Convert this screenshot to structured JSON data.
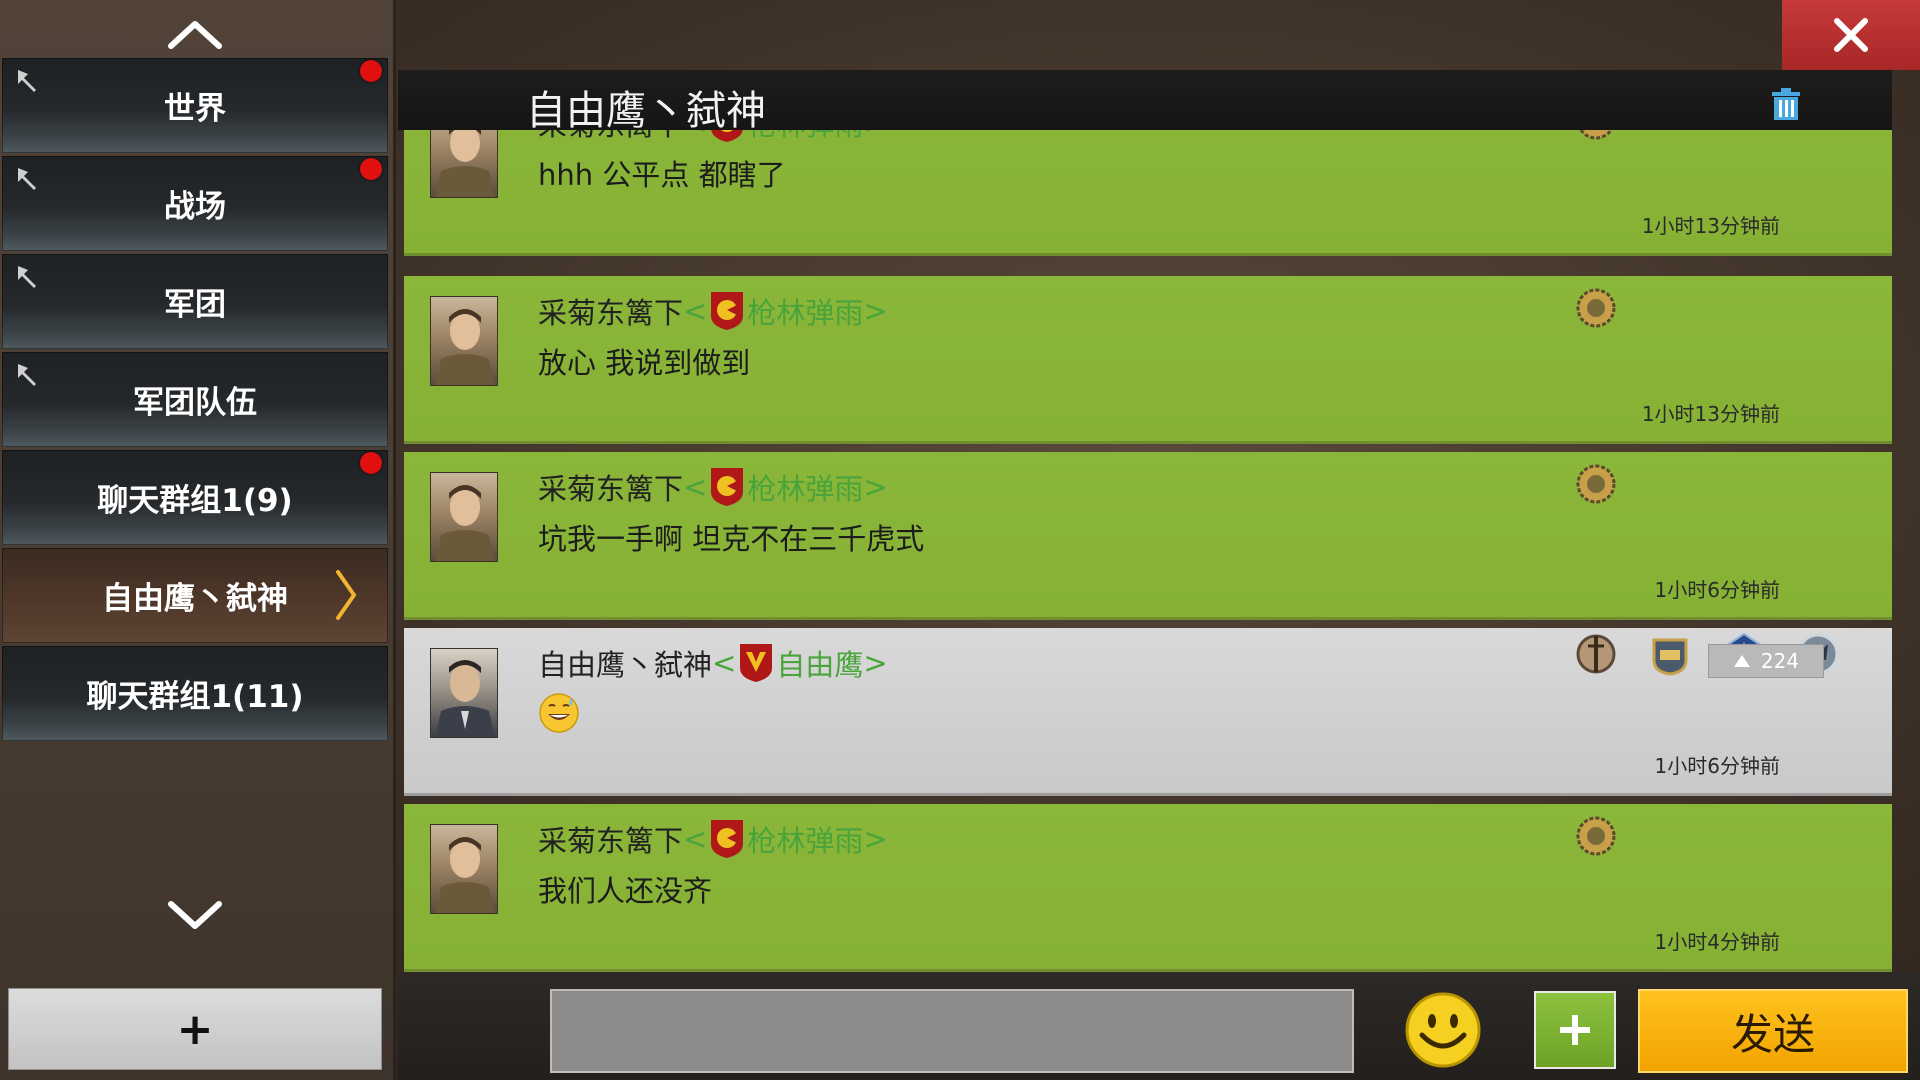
{
  "sidebar": {
    "items": [
      {
        "label": "世界",
        "pinned": true,
        "unread": true,
        "active": false
      },
      {
        "label": "战场",
        "pinned": true,
        "unread": true,
        "active": false
      },
      {
        "label": "军团",
        "pinned": true,
        "unread": false,
        "active": false
      },
      {
        "label": "军团队伍",
        "pinned": true,
        "unread": false,
        "active": false
      },
      {
        "label": "聊天群组1(9)",
        "pinned": false,
        "unread": true,
        "active": false
      },
      {
        "label": "自由鹰丶弑神",
        "pinned": false,
        "unread": false,
        "active": true
      },
      {
        "label": "聊天群组1(11)",
        "pinned": false,
        "unread": false,
        "active": false
      }
    ],
    "add_button_label": "+"
  },
  "header": {
    "title": "自由鹰丶弑神"
  },
  "messages": [
    {
      "sender": "采菊东篱下",
      "guild": "枪林弹雨",
      "text": "hhh 公平点 都瞎了",
      "time": "1小时13分钟前",
      "own": false
    },
    {
      "sender": "采菊东篱下",
      "guild": "枪林弹雨",
      "text": "放心 我说到做到",
      "time": "1小时13分钟前",
      "own": false
    },
    {
      "sender": "采菊东篱下",
      "guild": "枪林弹雨",
      "text": "坑我一手啊 坦克不在三千虎式",
      "time": "1小时6分钟前",
      "own": false
    },
    {
      "sender": "自由鹰丶弑神",
      "guild": "自由鹰",
      "text": "",
      "time": "1小时6分钟前",
      "own": true,
      "likes": "224"
    },
    {
      "sender": "采菊东篱下",
      "guild": "枪林弹雨",
      "text": "我们人还没齐",
      "time": "1小时4分钟前",
      "own": false
    }
  ],
  "bracket_open": "<",
  "bracket_close": ">",
  "input": {
    "value": "",
    "placeholder": ""
  },
  "buttons": {
    "plus_label": "+",
    "send_label": "发送"
  },
  "colors": {
    "message_bg": "#8ab63a",
    "own_message_bg": "#d9d9d9",
    "guild_name": "#4aa43b",
    "send_button": "#f7b20c",
    "close_button": "#b83030",
    "unread_dot": "#e01010"
  },
  "icons": {
    "close": "close-icon",
    "trash": "trash-icon",
    "emoji": "smiley-icon",
    "pin": "pin-icon",
    "scroll_up": "chevron-up-icon",
    "scroll_down": "chevron-down-icon",
    "likes": "thumb-up-icon"
  }
}
